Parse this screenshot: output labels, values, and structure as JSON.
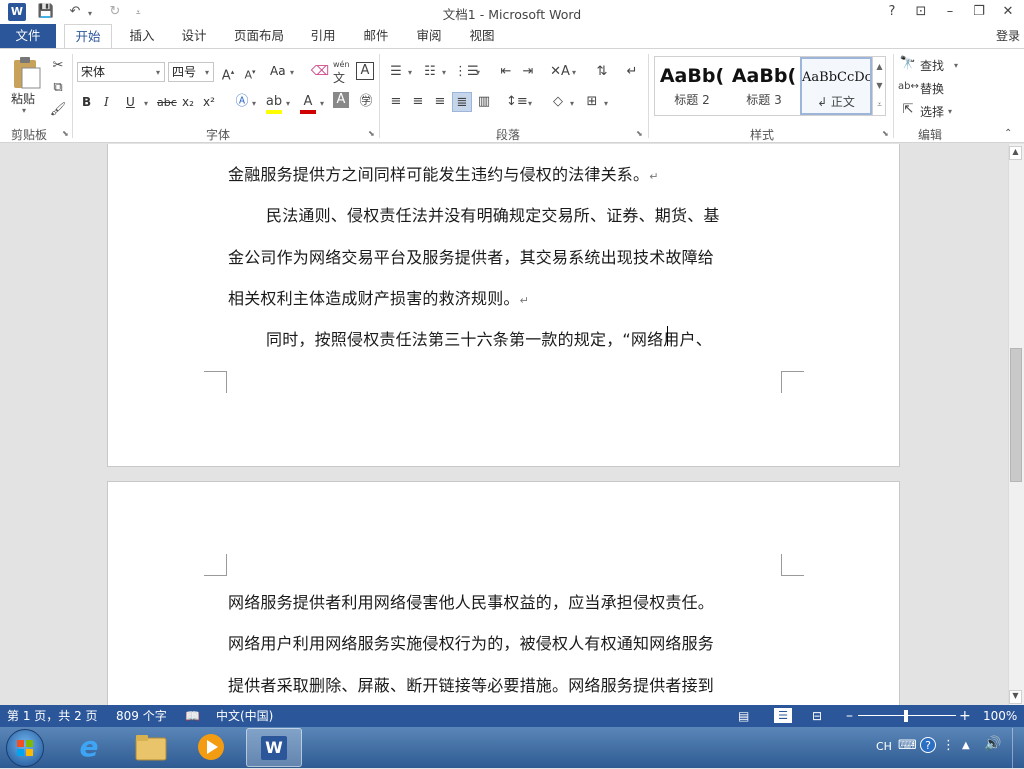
{
  "window": {
    "title": "文档1 - Microsoft Word",
    "help": "?",
    "login": "登录"
  },
  "tabs": [
    "文件",
    "开始",
    "插入",
    "设计",
    "页面布局",
    "引用",
    "邮件",
    "审阅",
    "视图"
  ],
  "ribbon": {
    "clipboard": {
      "paste": "粘贴",
      "label": "剪贴板"
    },
    "font": {
      "name": "宋体",
      "size": "四号",
      "label": "字体",
      "case_btn": "Aa",
      "bold": "B",
      "italic": "I",
      "underline": "U",
      "strike": "abc",
      "sub": "x₂",
      "sup": "x²",
      "phonetic": "wén"
    },
    "paragraph": {
      "label": "段落"
    },
    "styles": {
      "label": "样式",
      "items": [
        {
          "sample": "AaBb(",
          "name": "标题 2"
        },
        {
          "sample": "AaBb(",
          "name": "标题 3"
        },
        {
          "sample": "AaBbCcDc",
          "name": "↲ 正文"
        }
      ]
    },
    "editing": {
      "label": "编辑",
      "find": "查找",
      "replace": "替换",
      "select": "选择"
    }
  },
  "document": {
    "page1_lines": [
      "金融服务提供方之间同样可能发生违约与侵权的法律关系。",
      "民法通则、侵权责任法并没有明确规定交易所、证券、期货、基",
      "金公司作为网络交易平台及服务提供者，其交易系统出现技术故障给",
      "相关权利主体造成财产损害的救济规则。",
      "同时，按照侵权责任法第三十六条第一款的规定，“网络用户、"
    ],
    "page2_lines": [
      "网络服务提供者利用网络侵害他人民事权益的，应当承担侵权责任。",
      "网络用户利用网络服务实施侵权行为的，被侵权人有权通知网络服务",
      "提供者采取删除、屏蔽、断开链接等必要措施。网络服务提供者接到"
    ],
    "para_mark": "↵"
  },
  "status": {
    "page": "第 1 页，共 2 页",
    "words": "809 个字",
    "language": "中文(中国)",
    "zoom": "100%"
  },
  "taskbar": {
    "ime": "CH"
  },
  "colors": {
    "accent": "#2b579a",
    "font_color_red": "#d00000",
    "highlight_yellow": "#ffff00"
  }
}
